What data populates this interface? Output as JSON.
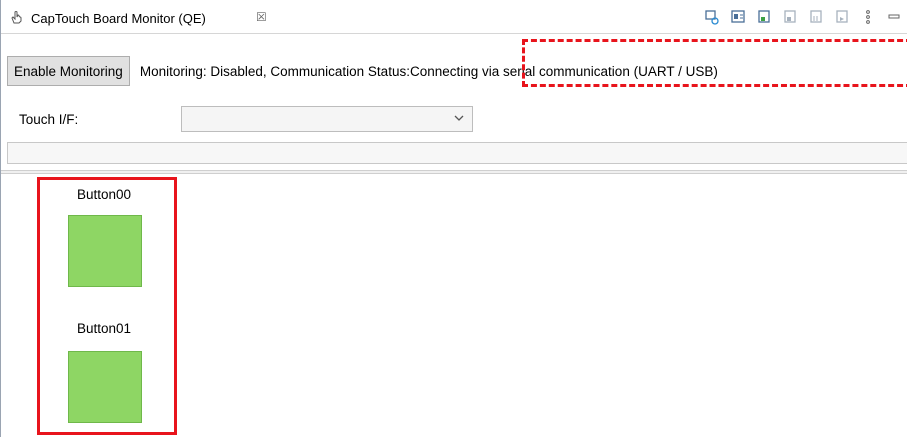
{
  "tab": {
    "title": "CapTouch Board Monitor (QE)",
    "close_symbol": "☒"
  },
  "toolbar": {
    "icons": [
      "monitor-refresh-icon",
      "board-icon",
      "window-icon",
      "window-grey-icon",
      "window-grey-icon-2",
      "window-grey-icon-3",
      "view-menu-icon",
      "minimize-icon"
    ]
  },
  "monitor": {
    "enable_button_label": "Enable Monitoring",
    "status_label": "Monitoring: Disabled, Communication Status: ",
    "status_value": "Connecting via serial communication (UART / USB)"
  },
  "touch_if": {
    "label": "Touch I/F:",
    "selected_value": ""
  },
  "touch_buttons": [
    {
      "label": "Button00",
      "color": "#8ed664"
    },
    {
      "label": "Button01",
      "color": "#8ed664"
    }
  ],
  "colors": {
    "highlight": "#e8141c",
    "pad": "#8ed664"
  }
}
